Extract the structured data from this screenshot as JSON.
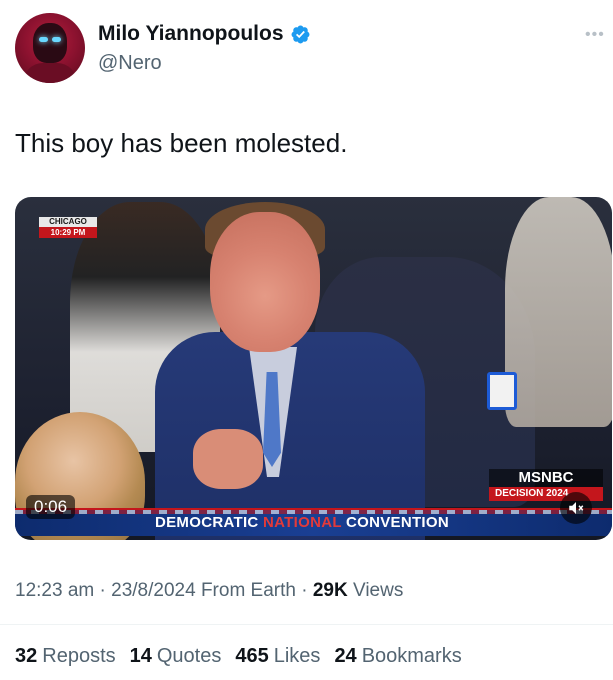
{
  "author": {
    "display_name": "Milo Yiannopoulos",
    "handle": "@Nero",
    "verified": true
  },
  "tweet": {
    "text": "This boy has been molested."
  },
  "media": {
    "duration": "0:06",
    "chyron_city": "CHICAGO",
    "chyron_time": "10:29 PM",
    "network_logo": "MSNBC",
    "network_sub": "DECISION 2024",
    "banner": {
      "word1": "DEMOCRATIC",
      "word2": "NATIONAL",
      "word3": "CONVENTION"
    }
  },
  "meta": {
    "time": "12:23 am",
    "date": "23/8/2024",
    "source": "From Earth",
    "views_count": "29K",
    "views_label": "Views"
  },
  "stats": {
    "reposts_count": "32",
    "reposts_label": "Reposts",
    "quotes_count": "14",
    "quotes_label": "Quotes",
    "likes_count": "465",
    "likes_label": "Likes",
    "bookmarks_count": "24",
    "bookmarks_label": "Bookmarks"
  },
  "colors": {
    "verified_blue": "#1d9bf0",
    "text_primary": "#0f1419",
    "text_secondary": "#536471",
    "msnbc_red": "#c4161c",
    "banner_blue": "#1a3f93"
  },
  "icons": {
    "verified": "verified-badge-icon",
    "more": "more-horizontal-icon",
    "mute": "speaker-muted-icon"
  }
}
